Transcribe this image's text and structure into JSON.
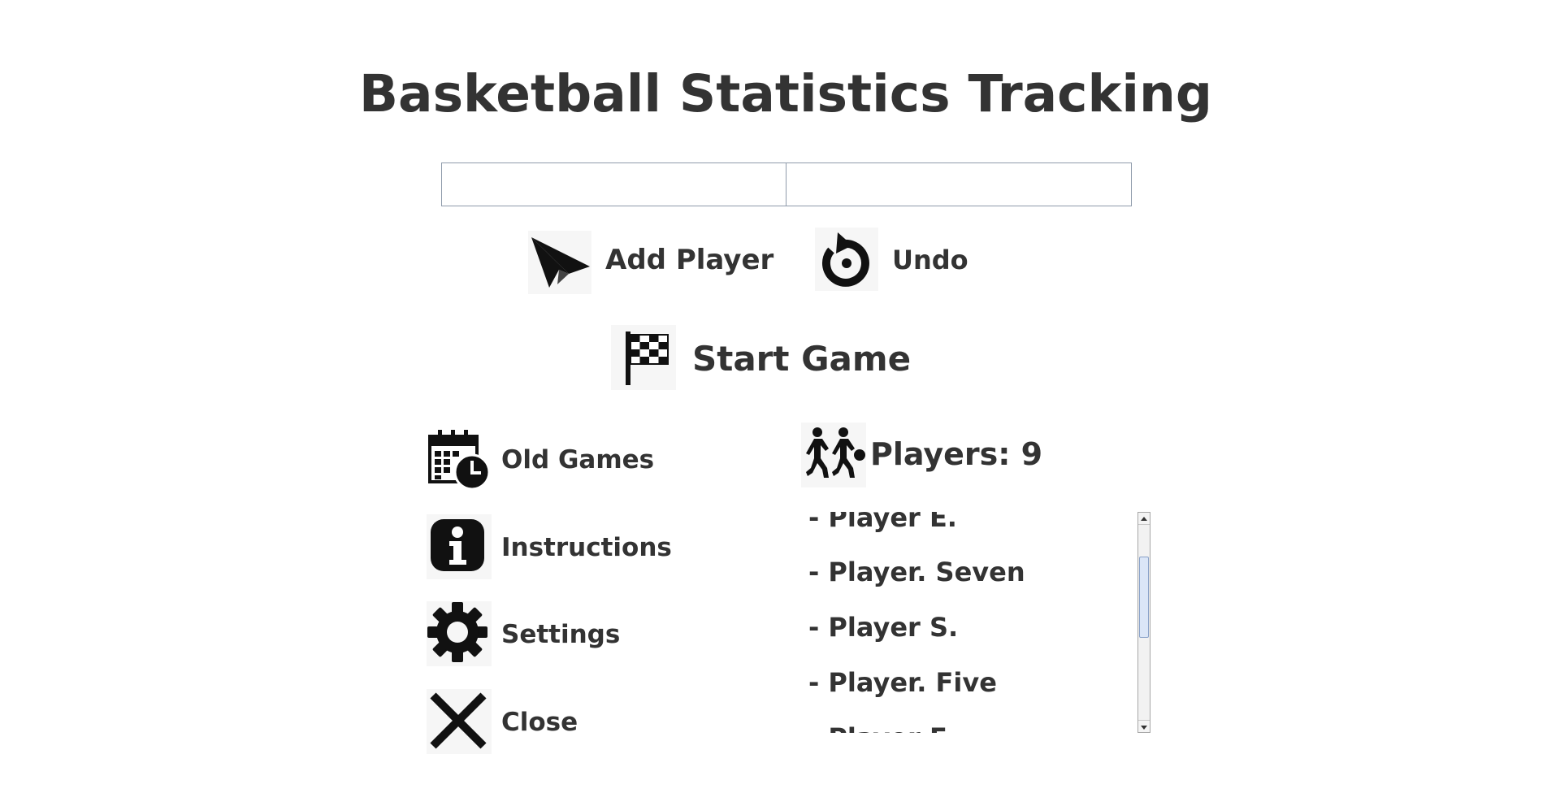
{
  "app": {
    "title": "Basketball Statistics Tracking"
  },
  "inputs": {
    "first_name": {
      "value": "",
      "placeholder": ""
    },
    "last_name": {
      "value": "",
      "placeholder": ""
    }
  },
  "actions": {
    "add_player": {
      "label": "Add Player",
      "icon": "paper-plane-icon"
    },
    "undo": {
      "label": "Undo",
      "icon": "undo-icon"
    },
    "start_game": {
      "label": "Start Game",
      "icon": "checkered-flag-icon"
    }
  },
  "menu": [
    {
      "label": "Old Games",
      "icon": "calendar-clock-icon"
    },
    {
      "label": "Instructions",
      "icon": "info-icon"
    },
    {
      "label": "Settings",
      "icon": "gear-icon"
    },
    {
      "label": "Close",
      "icon": "close-icon"
    }
  ],
  "players": {
    "header": "Players: 9",
    "icon": "players-icon",
    "items": [
      "- Player E.",
      "- Player. Seven",
      "- Player S.",
      "- Player. Five",
      "- Player F."
    ]
  },
  "colors": {
    "text": "#333333",
    "icon": "#111111",
    "field_border": "#8e9aaa"
  }
}
